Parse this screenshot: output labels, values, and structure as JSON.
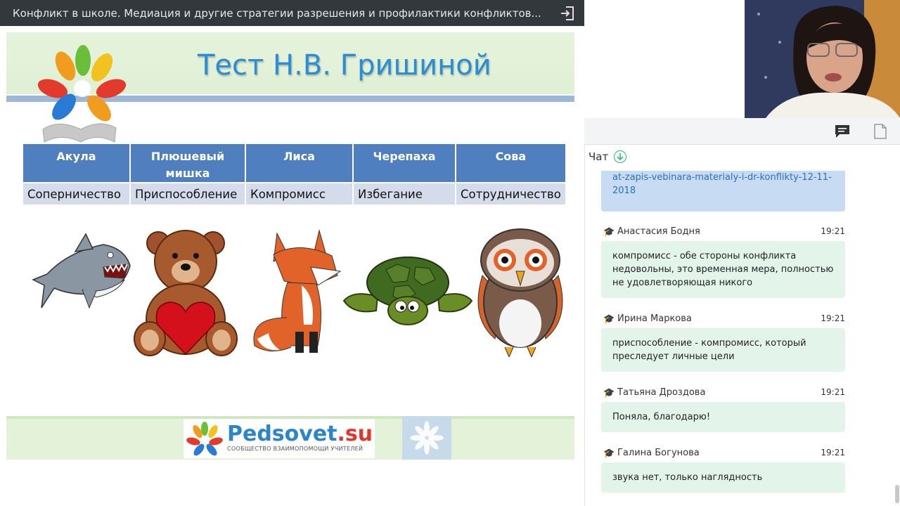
{
  "window": {
    "title": "Конфликт в школе. Медиация и другие стратегии разрешения и профилактики конфликтов..."
  },
  "slide": {
    "title": "Тест Н.В. Гришиной",
    "table": {
      "headers": [
        "Акула",
        "Плюшевый мишка",
        "Лиса",
        "Черепаха",
        "Сова"
      ],
      "values": [
        "Соперничество",
        "Приспособление",
        "Компромисс",
        "Избегание",
        "Сотрудничество"
      ]
    },
    "footer": {
      "brand": "Pedsovet",
      "brand_suffix": ".su",
      "tagline": "СООБЩЕСТВО ВЗАИМОПОМОЩИ УЧИТЕЛЕЙ"
    }
  },
  "panel": {
    "tabs": [
      {
        "icon": "chat-icon",
        "active": true
      },
      {
        "icon": "file-icon",
        "active": false
      }
    ],
    "chat_title": "Чат"
  },
  "chat": {
    "previous_message": "at-zapis-vebinara-materialy-i-dr-konflikty-12-11-2018",
    "messages": [
      {
        "author": "Анастасия Бодня",
        "time": "19:21",
        "text": "компромисс - обе стороны конфликта недовольны, это временная мера, полностью не удовлетворяющая никого"
      },
      {
        "author": "Ирина Маркова",
        "time": "19:21",
        "text": "приспособление - компромисс, который преследует личные цели"
      },
      {
        "author": "Татьяна Дроздова",
        "time": "19:21",
        "text": "Поняла, благодарю!"
      },
      {
        "author": "Галина Богунова",
        "time": "19:21",
        "text": "звука нет, только наглядность"
      }
    ]
  },
  "colors": {
    "topbar": "#33383d",
    "slide_title": "#2a8dd6",
    "table_header": "#4f7fbf",
    "table_cell": "#d4dbea",
    "chat_bubble": "#e3f4ea",
    "link_bubble": "#c7dcf3"
  }
}
